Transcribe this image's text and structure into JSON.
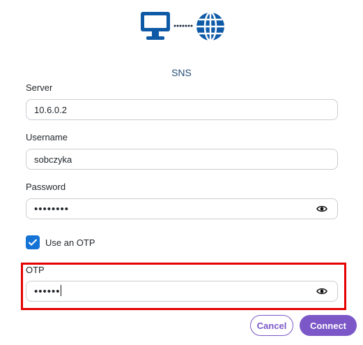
{
  "header": {
    "title": "SNS",
    "icons": [
      "monitor-icon",
      "globe-icon"
    ]
  },
  "form": {
    "server": {
      "label": "Server",
      "value": "10.6.0.2"
    },
    "username": {
      "label": "Username",
      "value": "sobczyka"
    },
    "password": {
      "label": "Password",
      "masked_value": "••••••••"
    },
    "use_otp": {
      "label": "Use an OTP",
      "checked": true
    },
    "otp": {
      "label": "OTP",
      "masked_value": "••••••"
    }
  },
  "buttons": {
    "cancel": "Cancel",
    "connect": "Connect"
  },
  "colors": {
    "accent": "#7b57c7",
    "checkbox": "#1673d6",
    "highlight": "#e50000",
    "title": "#244e7a"
  }
}
